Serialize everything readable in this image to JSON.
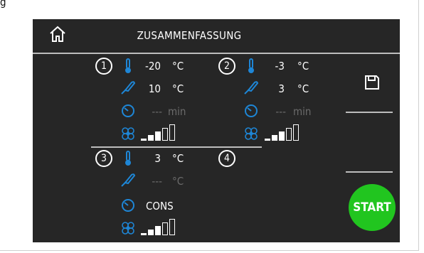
{
  "page": {
    "top_label": "g"
  },
  "header": {
    "title": "ZUSAMMENFASSUNG"
  },
  "zones": [
    {
      "number": "1",
      "temperature": "-20",
      "temp_unit": "°C",
      "probe": "10",
      "probe_unit": "°C",
      "time": "---",
      "time_unit": "min",
      "fan_level": 3
    },
    {
      "number": "2",
      "temperature": "-3",
      "temp_unit": "°C",
      "probe": "3",
      "probe_unit": "°C",
      "time": "---",
      "time_unit": "min",
      "fan_level": 3
    },
    {
      "number": "3",
      "temperature": "3",
      "temp_unit": "°C",
      "probe": "---",
      "probe_unit": "°C",
      "time": "CONS",
      "fan_level": 3
    },
    {
      "number": "4"
    }
  ],
  "buttons": {
    "start_label": "START"
  },
  "colors": {
    "panel": "#262626",
    "accent_blue": "#1e86d6",
    "start_green": "#21c51f",
    "dim": "#6b6b6b"
  }
}
